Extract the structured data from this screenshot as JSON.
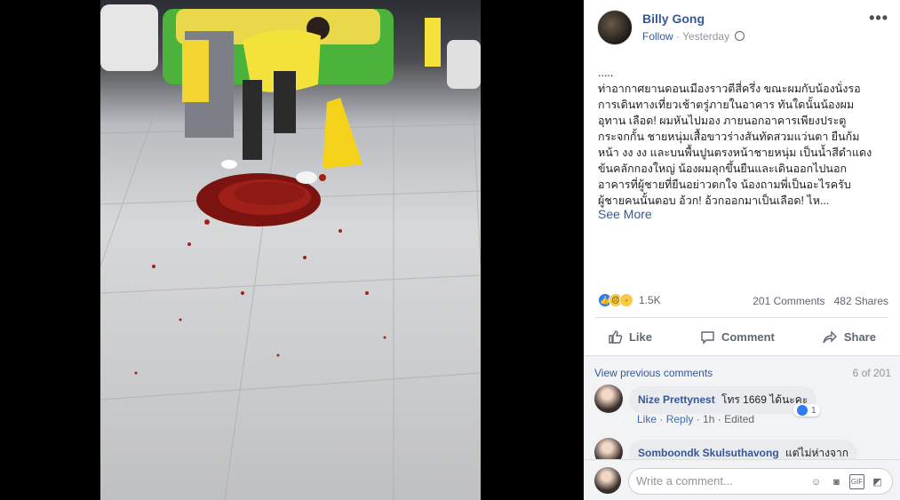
{
  "post": {
    "author": "Billy Gong",
    "follow_label": "Follow",
    "separator": " · ",
    "time": "Yesterday",
    "text": ".....\nท่าอากาศยานดอนเมืองราวตีสี่ครึ่ง ขณะผมกับน้องนั่งรอ\nการเดินทางเที่ยวเช้าตรู่ภายในอาคาร ทันใดนั้นน้องผม\nอุทาน เลือด! ผมหันไปมอง ภายนอกอาคารเพียงประตู\nกระจกกั้น ชายหนุ่มเสื้อขาวร่างสันทัดสวมแว่นตา ยืนก้ม\nหน้า งง งง และบนพื้นปูนตรงหน้าชายหนุ่ม เป็นน้ำสีดำแดง\nข้นคลักกองใหญ่ น้องผมลุกขึ้นยืนและเดินออกไปนอก\nอาคารที่ผู้ชายที่ยืนอย่าวตกใจ น้องถามพี่เป็นอะไรครับ\nผู้ชายคนนั้นตอบ อ้วก! อ้วกออกมาเป็นเลือด! ไห...",
    "see_more": "See More"
  },
  "stats": {
    "reaction_count": "1.5K",
    "comments": "201 Comments",
    "shares": "482 Shares"
  },
  "actions": {
    "like": "Like",
    "comment": "Comment",
    "share": "Share"
  },
  "comments": {
    "view_previous": "View previous comments",
    "count": "6 of 201",
    "items": [
      {
        "name": "Nize Prettynest",
        "text": "โทร 1669 ได้นะคะ",
        "like": "Like",
        "reply": "Reply",
        "time": "1h",
        "edited": "Edited",
        "reaction_count": "1"
      },
      {
        "name": "Somboondk Skulsuthavong",
        "text": "แต่ไม่ห่างจาก"
      }
    ],
    "write_placeholder": "Write a comment...",
    "gif_label": "GIF"
  },
  "colors": {
    "link": "#365899",
    "like_blue": "#2f7cf6",
    "muted": "#606770",
    "background": "#000000"
  },
  "icons": [
    "more-options-icon",
    "globe-icon",
    "like-icon",
    "comment-icon",
    "share-icon",
    "emoji-icon",
    "camera-icon",
    "gif-icon",
    "sticker-icon"
  ]
}
